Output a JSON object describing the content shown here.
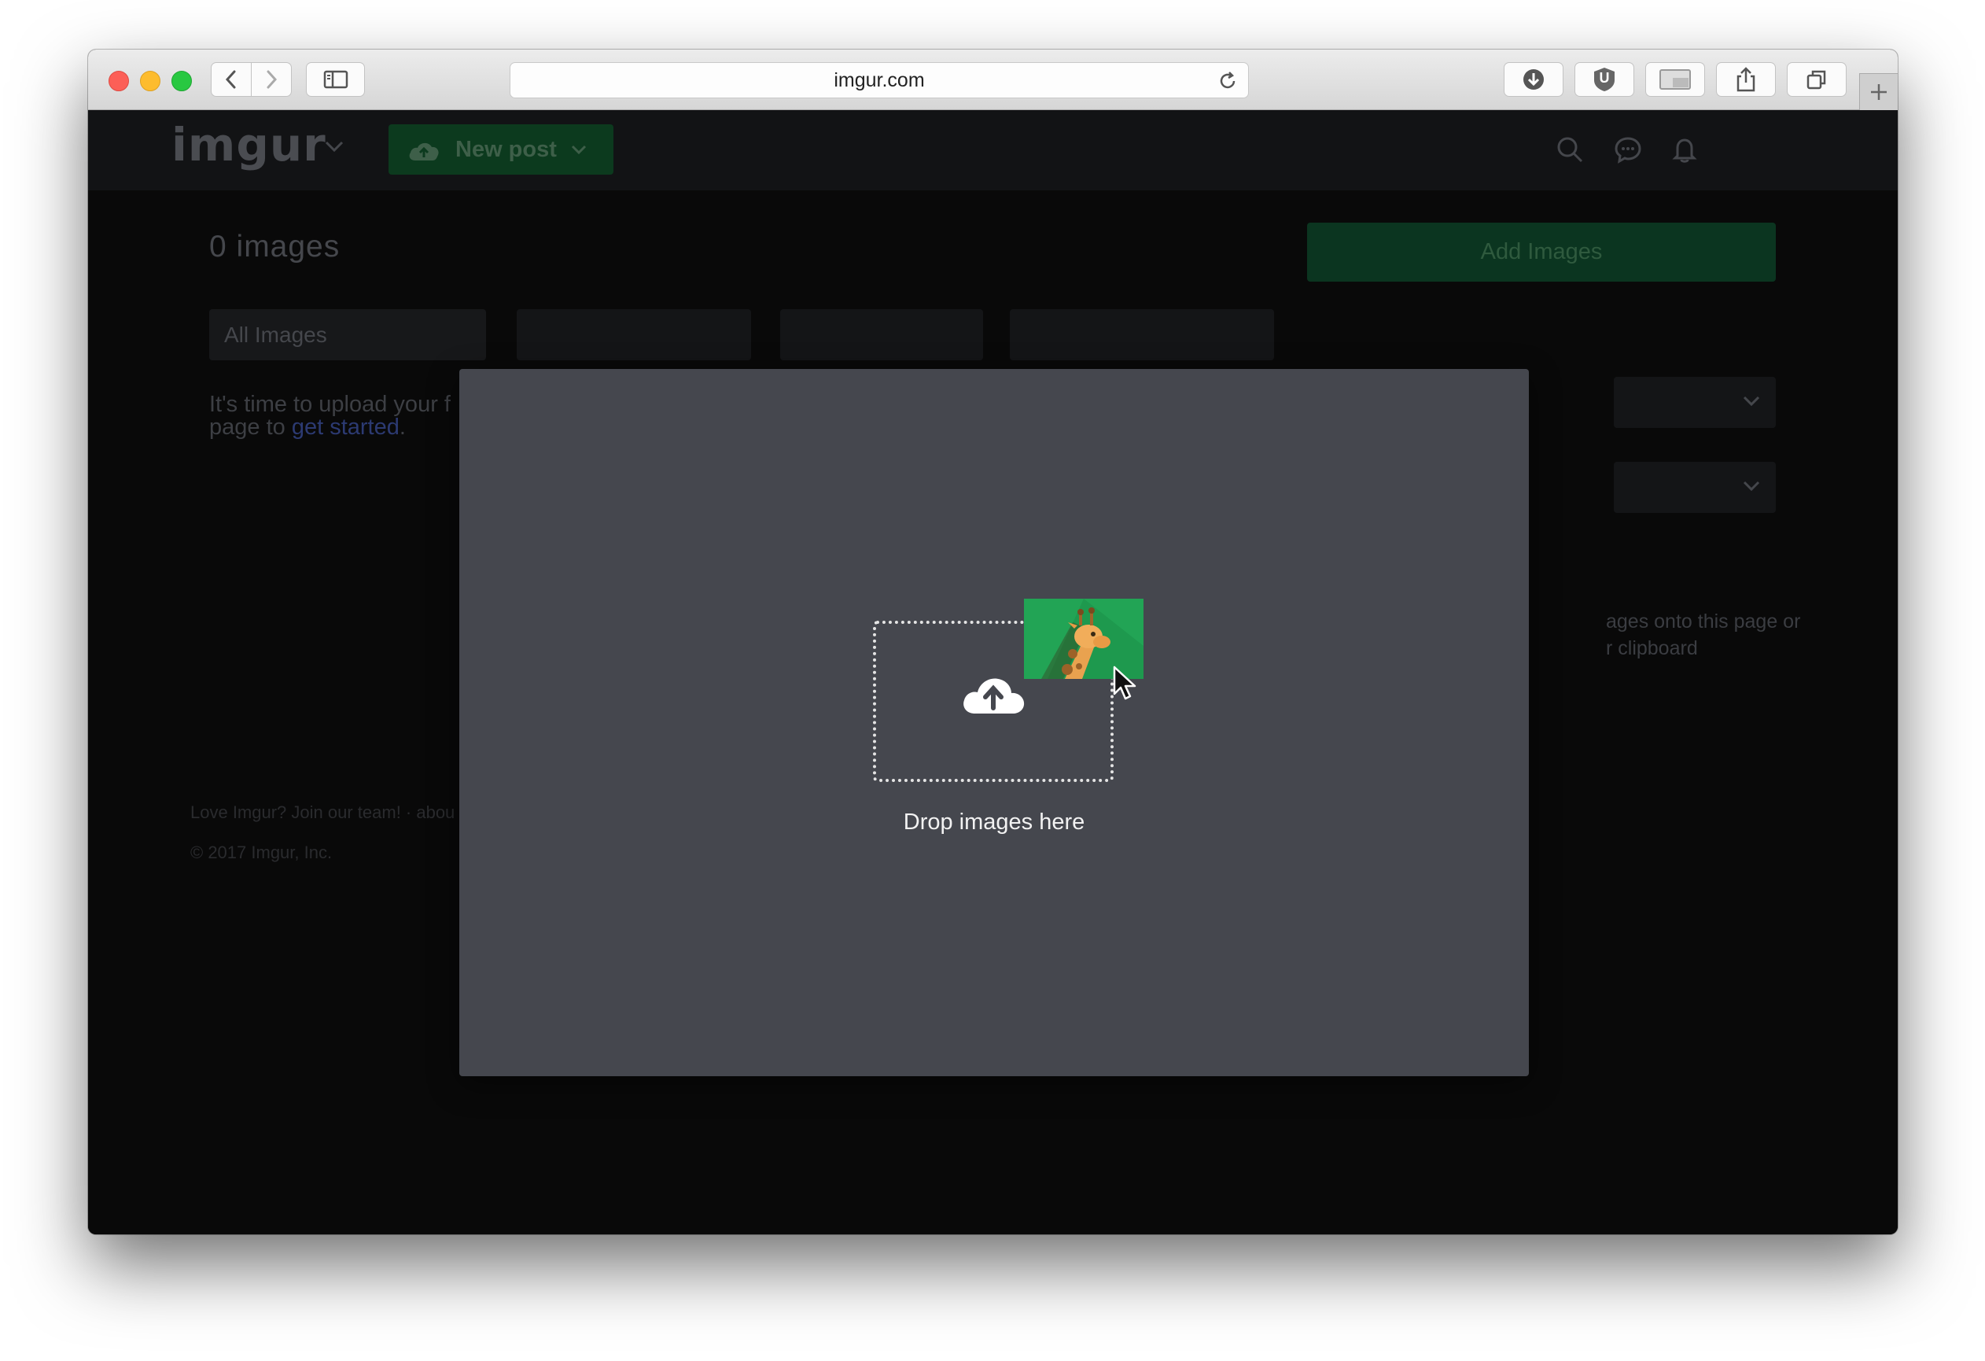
{
  "browser": {
    "url": "imgur.com",
    "icons": {
      "back": "chevron-left-icon",
      "forward": "chevron-right-icon",
      "sidebar": "sidebar-icon",
      "reload": "reload-icon",
      "downloads": "download-icon",
      "extension": "ublock-icon",
      "share": "share-icon",
      "tabs": "tabs-icon",
      "new_tab": "plus-icon"
    },
    "extension_letter": "U"
  },
  "header": {
    "logo": "imgur",
    "new_post_label": "New post",
    "icons": [
      "search-icon",
      "messages-icon",
      "notifications-icon"
    ]
  },
  "main": {
    "image_count": "0 images",
    "add_images_label": "Add Images",
    "filter_value": "All Images",
    "empty_line1": "It's time to upload your f",
    "empty_line2_prefix": "page to ",
    "empty_link": "get started",
    "empty_line2_suffix": "."
  },
  "sidebar": {
    "hint_line1": "ages onto this page or",
    "hint_line2": "r clipboard"
  },
  "footer": {
    "line1": "Love Imgur? Join our team! · abou",
    "copyright": "© 2017 Imgur, Inc."
  },
  "modal": {
    "drop_label": "Drop images here",
    "image_icon": "giraffe-image-icon",
    "upload_icon": "cloud-upload-icon"
  },
  "colors": {
    "accent_green": "#1bb76e",
    "modal_bg": "#45474e",
    "page_bg": "#090909"
  }
}
